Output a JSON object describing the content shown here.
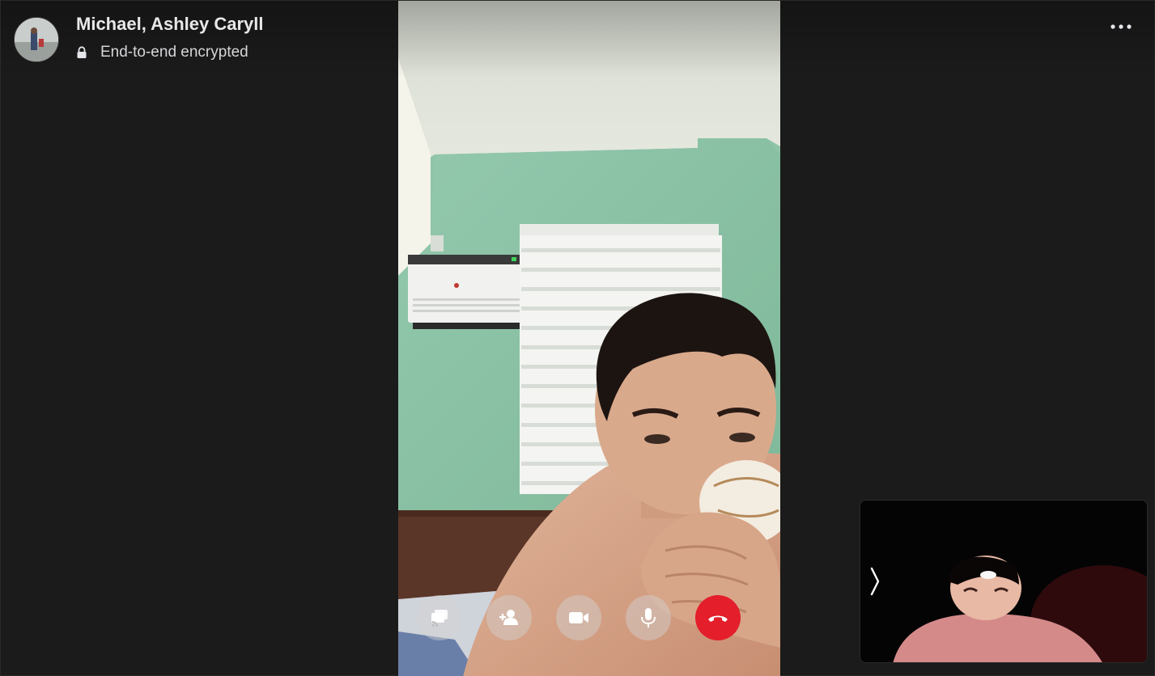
{
  "header": {
    "title": "Michael, Ashley Caryll",
    "encryption_label": "End-to-end encrypted"
  },
  "controls": [
    {
      "name": "share-screen",
      "icon": "screen-share-icon"
    },
    {
      "name": "add-person",
      "icon": "add-person-icon"
    },
    {
      "name": "video",
      "icon": "video-camera-icon"
    },
    {
      "name": "mute",
      "icon": "microphone-icon"
    },
    {
      "name": "end-call",
      "icon": "phone-hangup-icon"
    }
  ],
  "colors": {
    "background": "#1b1b1b",
    "end_call": "#e41e2b",
    "control_bg": "rgba(210,210,210,0.45)",
    "wall": "#8fc4a8"
  }
}
